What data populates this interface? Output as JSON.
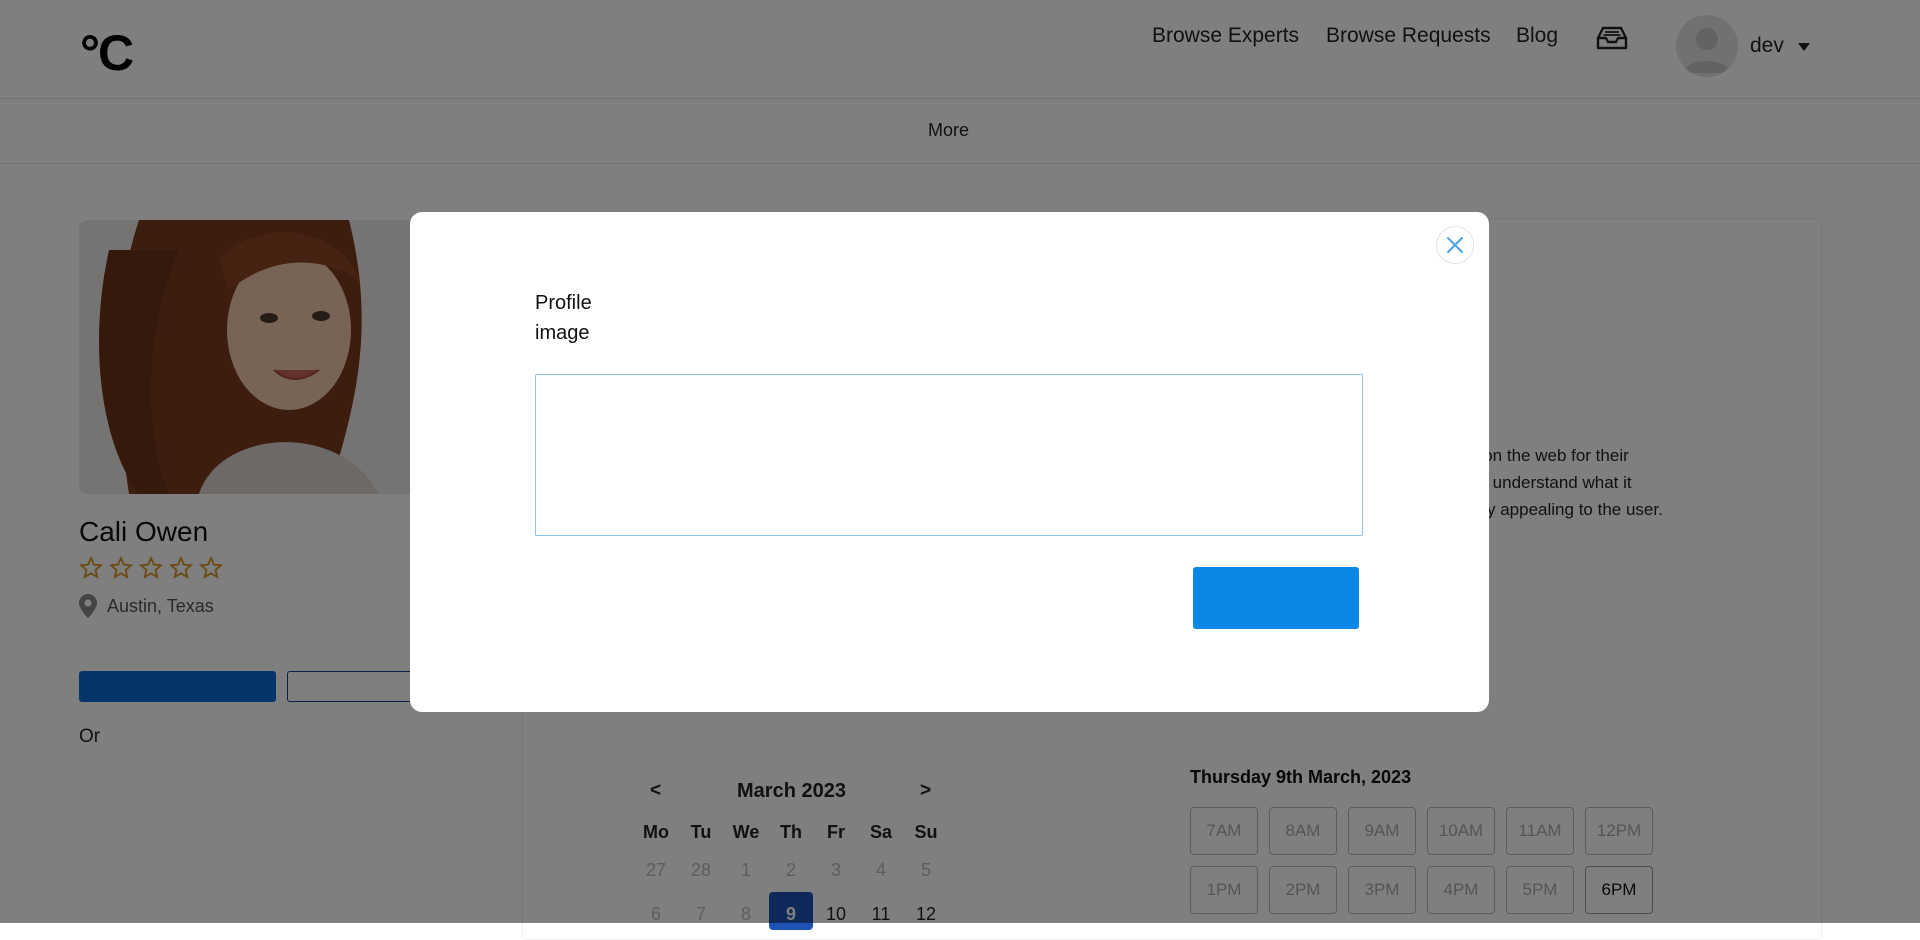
{
  "header": {
    "logo": "°C",
    "nav": [
      "Browse Experts",
      "Browse Requests",
      "Blog"
    ],
    "inbox_icon": "inbox-icon",
    "user": "dev"
  },
  "subnav": {
    "more": "More"
  },
  "profile": {
    "name": "Cali Owen",
    "rating": 0,
    "rating_max": 5,
    "location": "Austin, Texas",
    "or_text": "Or"
  },
  "bio": {
    "lines": [
      "y on the web for their",
      "ey understand what it",
      "ally appealing to the user."
    ]
  },
  "calendar": {
    "prev": "<",
    "next": ">",
    "month": "March 2023",
    "weekdays": [
      "Mo",
      "Tu",
      "We",
      "Th",
      "Fr",
      "Sa",
      "Su"
    ],
    "row1": [
      "27",
      "28",
      "1",
      "2",
      "3",
      "4",
      "5"
    ],
    "row2": [
      "6",
      "7",
      "8",
      "9",
      "10",
      "11",
      "12"
    ],
    "selected": "9"
  },
  "slots": {
    "title": "Thursday 9th March, 2023",
    "row1": [
      "7AM",
      "8AM",
      "9AM",
      "10AM",
      "11AM",
      "12PM"
    ],
    "row2": [
      "1PM",
      "2PM",
      "3PM",
      "4PM",
      "5PM",
      "6PM"
    ],
    "active": "6PM"
  },
  "modal": {
    "label": "Profile image",
    "close_icon": "close-icon",
    "accent": "#0a87e6"
  }
}
